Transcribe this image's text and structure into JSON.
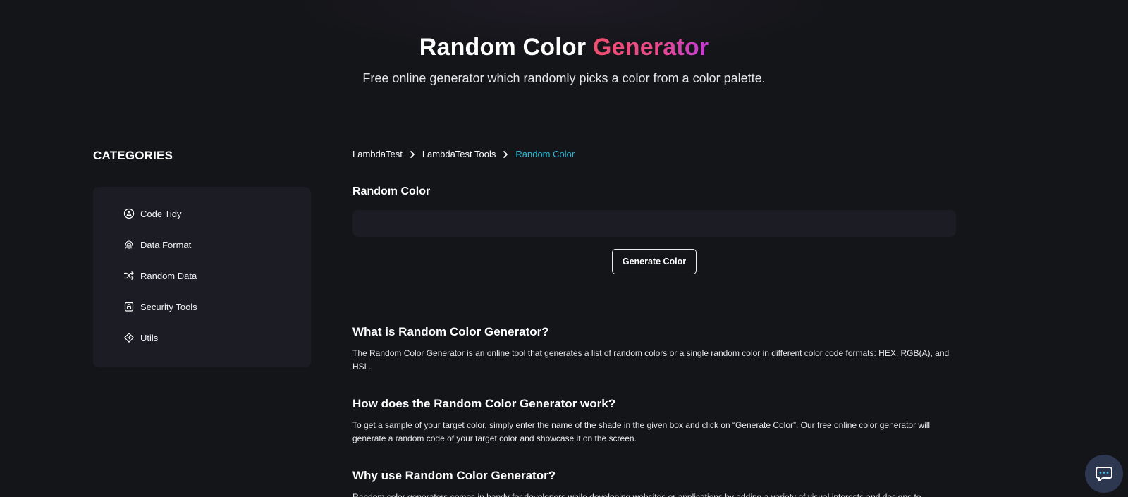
{
  "hero": {
    "title_main": "Random Color",
    "title_accent": "Generator",
    "subtitle": "Free online generator which randomly picks a color from a color palette."
  },
  "categories": {
    "heading": "CATEGORIES",
    "items": [
      {
        "label": "Code Tidy",
        "icon": "code-tidy-icon"
      },
      {
        "label": "Data Format",
        "icon": "fingerprint-icon"
      },
      {
        "label": "Random Data",
        "icon": "shuffle-icon"
      },
      {
        "label": "Security Tools",
        "icon": "lock-icon"
      },
      {
        "label": "Utils",
        "icon": "diamond-icon"
      }
    ]
  },
  "breadcrumb": {
    "items": [
      "LambdaTest",
      "LambdaTest Tools"
    ],
    "current": "Random Color"
  },
  "tool": {
    "label": "Random Color",
    "output_value": "",
    "button_label": "Generate Color"
  },
  "sections": [
    {
      "heading": "What is Random Color Generator?",
      "text": "The Random Color Generator is an online tool that generates a list of random colors or a single random color in different color code formats: HEX, RGB(A), and HSL."
    },
    {
      "heading": "How does the Random Color Generator work?",
      "text": "To get a sample of your target color, simply enter the name of the shade in the given box and click on “Generate Color”. Our free online color generator will generate a random code of your target color and showcase it on the screen."
    },
    {
      "heading": "Why use Random Color Generator?",
      "text": "Random color generators comes in handy for developers while developing websites or applications by adding a variety of visual interests and designs to"
    }
  ],
  "chat": {
    "icon": "chat-icon"
  },
  "colors": {
    "background": "#141519",
    "panel": "#1c1c25",
    "accent_start": "#f04e6e",
    "accent_end": "#c23ad6",
    "breadcrumb_current": "#27b8d4",
    "chat_button": "#2d3750"
  }
}
